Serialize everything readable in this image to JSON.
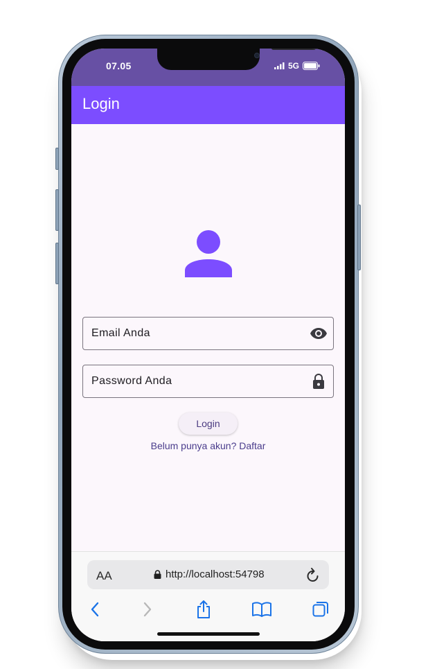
{
  "status": {
    "time": "07.05",
    "network": "5G"
  },
  "app_bar": {
    "title": "Login"
  },
  "form": {
    "email_placeholder": "Email Anda",
    "password_placeholder": "Password Anda",
    "email_icon": "eye-icon",
    "password_icon": "lock-icon",
    "login_label": "Login",
    "register_link": "Belum punya akun? Daftar"
  },
  "browser": {
    "text_size_label": "AA",
    "url": "http://localhost:54798"
  },
  "colors": {
    "status_bar": "#6750a4",
    "app_bar": "#7c4dff",
    "avatar": "#7c4dff",
    "background": "#fcf7fc"
  }
}
